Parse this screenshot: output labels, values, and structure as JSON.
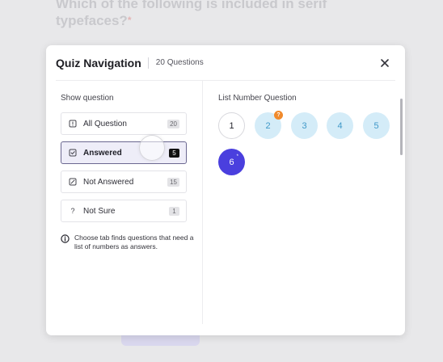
{
  "background": {
    "question_text": "Which of the following is included in serif typefaces?",
    "required_mark": "*"
  },
  "modal": {
    "title": "Quiz Navigation",
    "question_count": "20 Questions",
    "close_icon": "close-icon"
  },
  "filters": {
    "label": "Show question",
    "items": [
      {
        "label": "All Question",
        "count": "20",
        "icon": "list-icon",
        "active": false
      },
      {
        "label": "Answered",
        "count": "5",
        "icon": "check-square-icon",
        "active": true
      },
      {
        "label": "Not Answered",
        "count": "15",
        "icon": "slash-square-icon",
        "active": false
      },
      {
        "label": "Not Sure",
        "count": "1",
        "icon": "question-mark-icon",
        "active": false
      }
    ],
    "info_text": "Choose tab finds questions that need a list of numbers as answers.",
    "info_icon": "info-icon"
  },
  "questions": {
    "label": "List Number Question",
    "numbers": [
      {
        "num": "1",
        "state": "current"
      },
      {
        "num": "2",
        "state": "answered",
        "badge": "?"
      },
      {
        "num": "3",
        "state": "answered"
      },
      {
        "num": "4",
        "state": "answered"
      },
      {
        "num": "5",
        "state": "answered"
      },
      {
        "num": "6",
        "state": "selected",
        "mark": "*"
      }
    ]
  },
  "colors": {
    "accent": "#4a3fde",
    "answered_bg": "#d4ecf8",
    "answered_text": "#3f98c8",
    "badge": "#f08a2c"
  }
}
